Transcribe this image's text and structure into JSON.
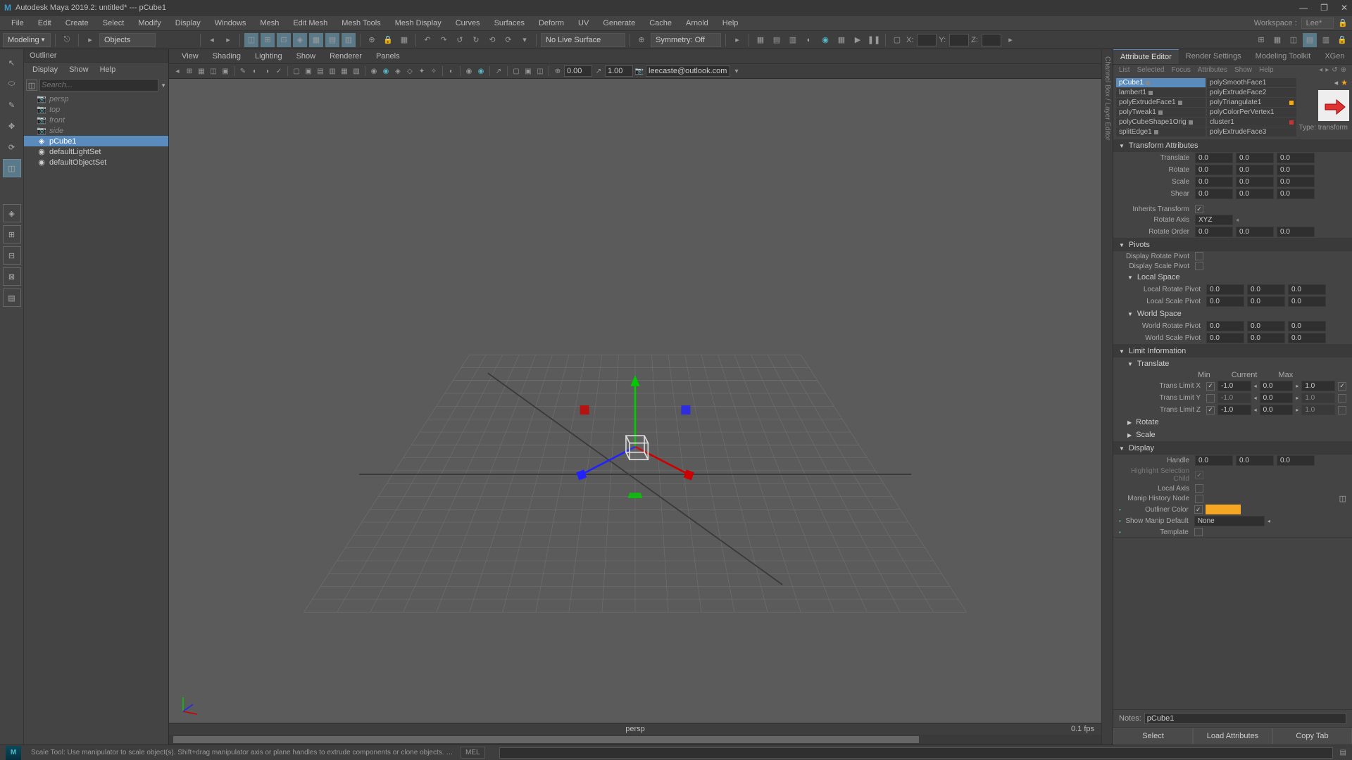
{
  "titlebar": {
    "logo": "M",
    "title": "Autodesk Maya 2019.2: untitled*  ---  pCube1"
  },
  "menubar": {
    "items": [
      "File",
      "Edit",
      "Create",
      "Select",
      "Modify",
      "Display",
      "Windows",
      "Mesh",
      "Edit Mesh",
      "Mesh Tools",
      "Mesh Display",
      "Curves",
      "Surfaces",
      "Deform",
      "UV",
      "Generate",
      "Cache",
      "Arnold",
      "Help"
    ],
    "workspace_label": "Workspace :",
    "workspace_value": "Lee*"
  },
  "shelf": {
    "mode": "Modeling",
    "breadcrumb": "Objects",
    "no_live": "No Live Surface",
    "symmetry": "Symmetry: Off",
    "coord_x": "X:",
    "coord_y": "Y:",
    "coord_z": "Z:"
  },
  "outliner": {
    "title": "Outliner",
    "menu": [
      "Display",
      "Show",
      "Help"
    ],
    "search_ph": "Search...",
    "items": [
      {
        "label": "persp",
        "dim": true,
        "icon": "📷"
      },
      {
        "label": "top",
        "dim": true,
        "icon": "📷"
      },
      {
        "label": "front",
        "dim": true,
        "icon": "📷"
      },
      {
        "label": "side",
        "dim": true,
        "icon": "📷"
      },
      {
        "label": "pCube1",
        "dim": false,
        "icon": "◈",
        "sel": true
      },
      {
        "label": "defaultLightSet",
        "dim": false,
        "icon": "◉"
      },
      {
        "label": "defaultObjectSet",
        "dim": false,
        "icon": "◉"
      }
    ]
  },
  "viewport": {
    "menu": [
      "View",
      "Shading",
      "Lighting",
      "Show",
      "Renderer",
      "Panels"
    ],
    "sample_val1": "0.00",
    "sample_val2": "1.00",
    "user": "leecaste@outlook.com",
    "cam": "persp",
    "fps": "0.1 fps"
  },
  "vertical_label": "Channel Box / Layer Editor",
  "attr": {
    "tabs": [
      "Attribute Editor",
      "Render Settings",
      "Modeling Toolkit",
      "XGen"
    ],
    "sub": [
      "List",
      "Selected",
      "Focus",
      "Attributes",
      "Show",
      "Help"
    ],
    "nodes_l": [
      "pCube1",
      "lambert1",
      "polyExtrudeFace1",
      "polyTweak1",
      "polyCubeShape1Orig",
      "splitEdge1"
    ],
    "nodes_r": [
      "polySmoothFace1",
      "polyExtrudeFace2",
      "polyTriangulate1",
      "polyColorPerVertex1",
      "cluster1",
      "polyExtrudeFace3"
    ],
    "type": "Type: transform",
    "notes_label": "Notes:",
    "notes_value": "pCube1",
    "btns": [
      "Select",
      "Load Attributes",
      "Copy Tab"
    ],
    "transform": {
      "title": "Transform Attributes",
      "translate": "Translate",
      "rotate": "Rotate",
      "scale": "Scale",
      "shear": "Shear",
      "inherits": "Inherits Transform",
      "rotate_axis": "Rotate Axis",
      "rotate_axis_val": "XYZ",
      "rotate_order": "Rotate Order",
      "v000": "0.0"
    },
    "pivots": {
      "title": "Pivots",
      "drp": "Display Rotate Pivot",
      "dsp": "Display Scale Pivot",
      "local": "Local Space",
      "lrp": "Local Rotate Pivot",
      "lsp": "Local Scale Pivot",
      "world": "World Space",
      "wrp": "World Rotate Pivot",
      "wsp": "World Scale Pivot"
    },
    "limit": {
      "title": "Limit Information",
      "trans": "Translate",
      "min": "Min",
      "cur": "Current",
      "max": "Max",
      "tlx": "Trans Limit X",
      "tly": "Trans Limit Y",
      "tlz": "Trans Limit Z",
      "neg1": "-1.0",
      "pos1": "1.0",
      "zero": "0.0",
      "rot": "Rotate",
      "scl": "Scale"
    },
    "display": {
      "title": "Display",
      "handle": "Handle",
      "hsc": "Highlight Selection Child",
      "la": "Local Axis",
      "mhn": "Manip History Node",
      "oc": "Outliner Color",
      "smd": "Show Manip Default",
      "smd_val": "None",
      "tmpl": "Template"
    }
  },
  "status": {
    "msg": "Scale Tool: Use manipulator to scale object(s). Shift+drag manipulator axis or plane handles to extrude components or clone objects. Ctrl+Shift+LMB+drag to constrain scaling to o",
    "mel": "MEL"
  }
}
